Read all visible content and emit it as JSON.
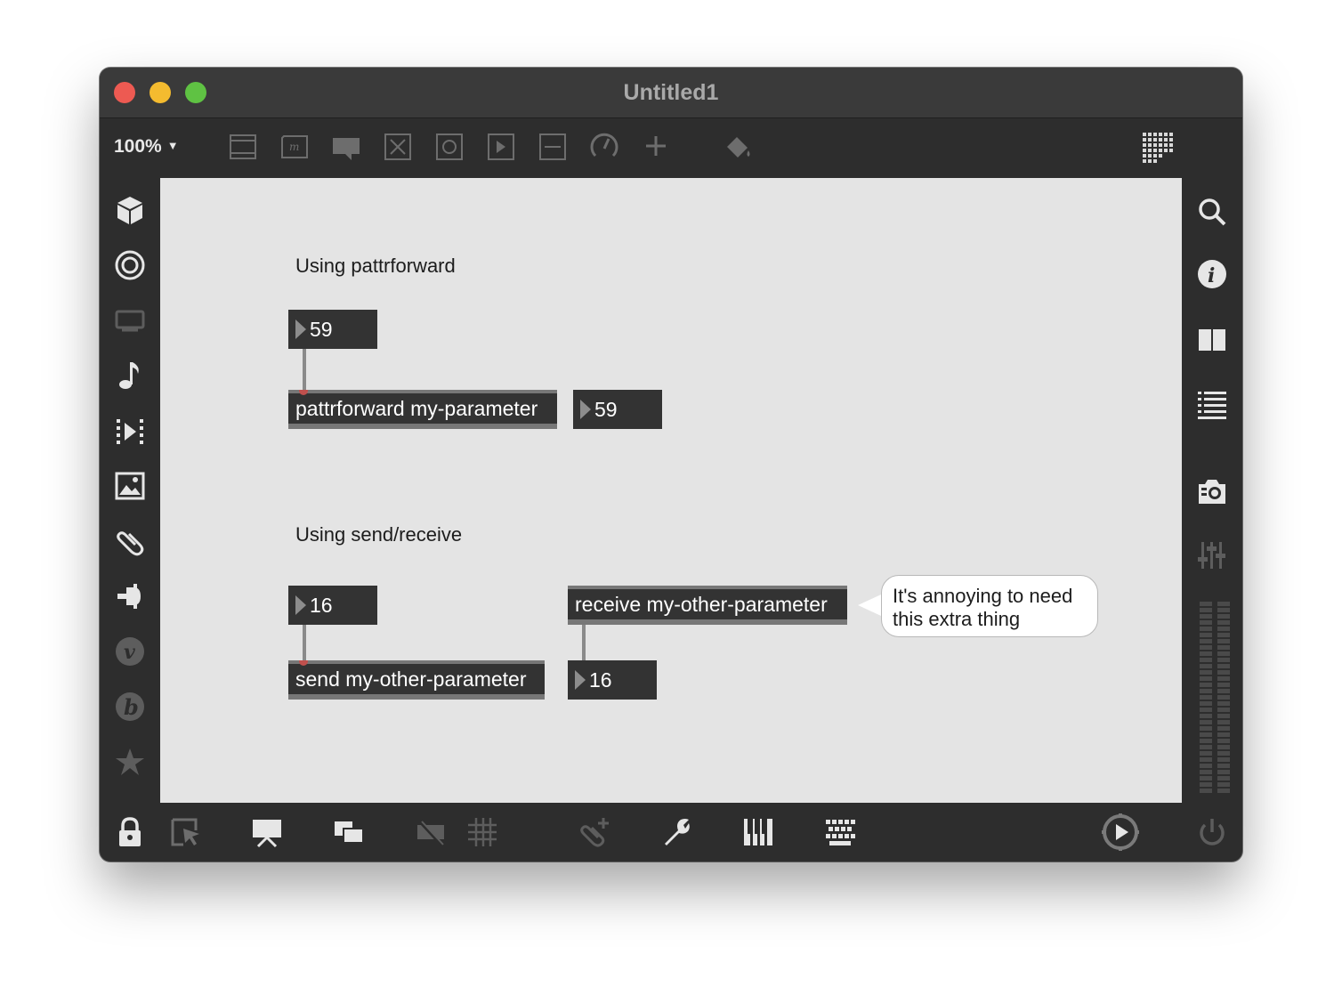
{
  "window": {
    "title": "Untitled1"
  },
  "toolbar": {
    "zoom": "100%",
    "zoom_caret": "▼"
  },
  "patch": {
    "section1_comment": "Using pattrforward",
    "section1_number_in": "59",
    "section1_object": "pattrforward my-parameter",
    "section1_number_out": "59",
    "section2_comment": "Using send/receive",
    "section2_number_in": "16",
    "section2_send": "send my-other-parameter",
    "section2_receive": "receive my-other-parameter",
    "section2_number_out": "16",
    "bubble_line1": "It's annoying to need",
    "bubble_line2": "this extra thing"
  },
  "colors": {
    "window_bg": "#2d2d2d",
    "canvas_bg": "#e4e4e4",
    "object_bg": "#333333",
    "close": "#ed5a52",
    "minimize": "#f4bb2f",
    "maximize": "#5fc243"
  }
}
